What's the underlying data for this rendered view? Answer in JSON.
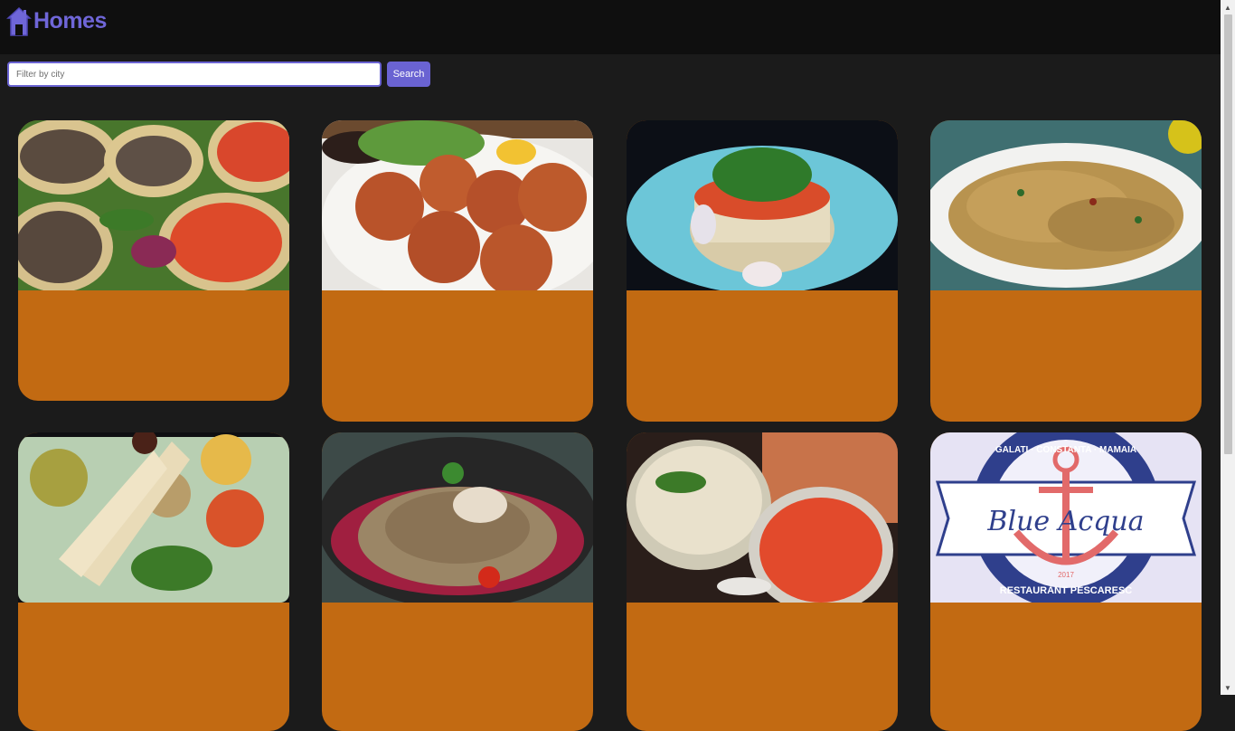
{
  "header": {
    "brand_name": "Homes",
    "brand_icon": "home-icon",
    "brand_color": "#6f66d8"
  },
  "filter": {
    "placeholder": "Filter by city",
    "value": "",
    "button_label": "Search",
    "accent_color": "#6a63d2"
  },
  "cards_accent_color": "#c26a12",
  "cards": [
    {
      "image": "bruschetta-food-photo"
    },
    {
      "image": "fried-balls-food-photo"
    },
    {
      "image": "tartare-plate-food-photo"
    },
    {
      "image": "spaghetti-food-photo"
    },
    {
      "image": "dips-platter-food-photo"
    },
    {
      "image": "risotto-food-photo"
    },
    {
      "image": "hummus-tomato-food-photo"
    },
    {
      "image": "blue-acqua-logo",
      "logo_text": "Blue Acqua",
      "logo_ring_text": "GALATI · CONSTANTA · MAMAIA",
      "logo_bottom_text": "RESTAURANT PESCARESC",
      "logo_year": "2017"
    }
  ]
}
